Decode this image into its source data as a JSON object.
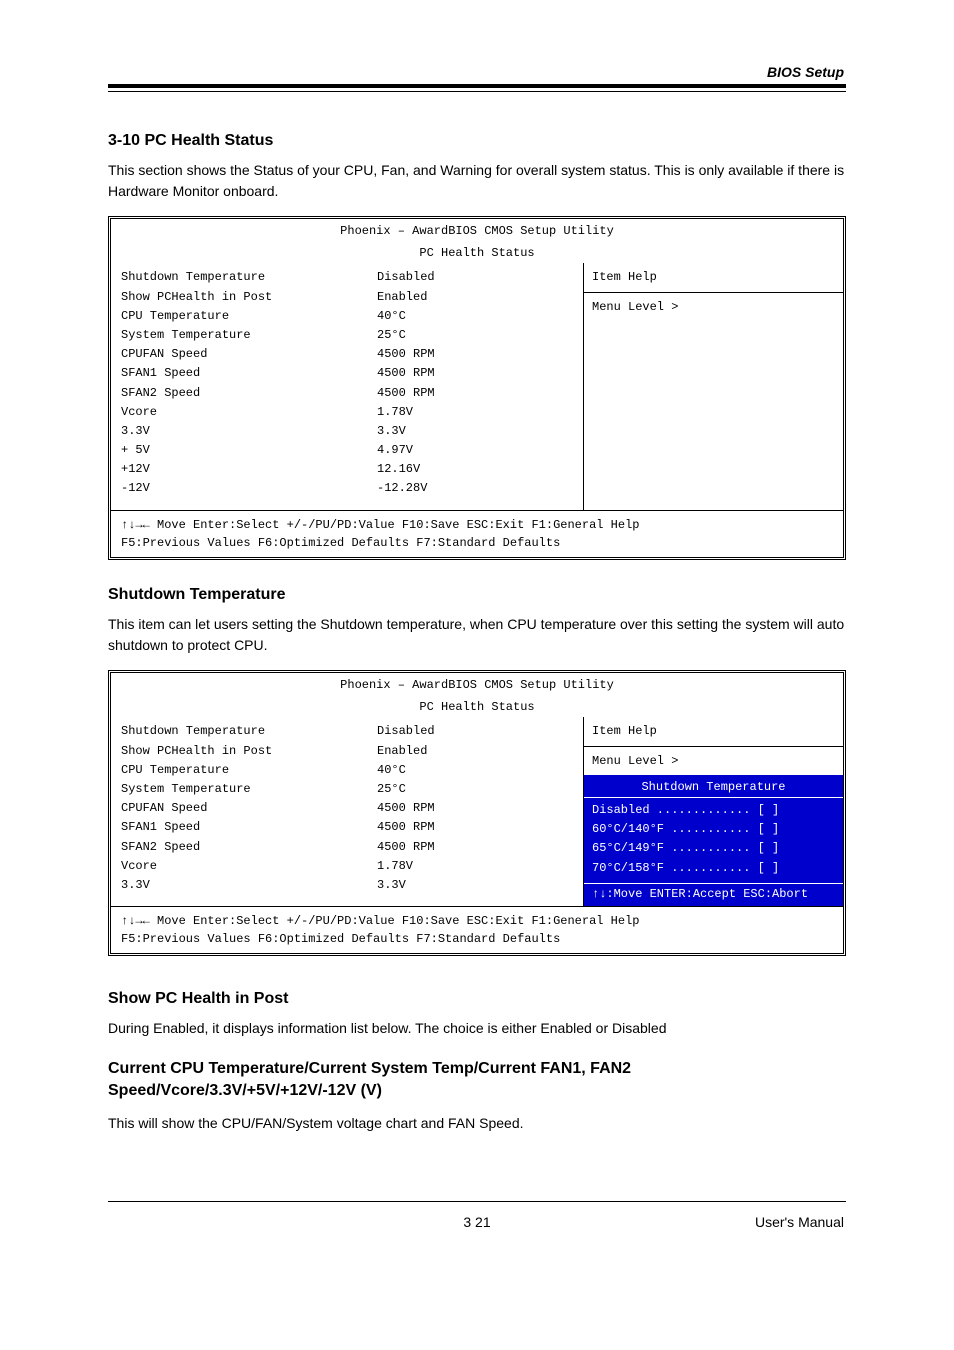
{
  "header": "BIOS Setup",
  "section1": {
    "title": "3-10 PC Health Status",
    "sub": "This section shows the Status of your CPU, Fan, and Warning for overall system status. This is only available if there is Hardware Monitor onboard."
  },
  "bios1": {
    "title": "Phoenix – AwardBIOS CMOS Setup Utility",
    "left_header": "PC Health Status",
    "right_title": "Item Help",
    "right_body": "Menu Level  >",
    "left_rows": [
      {
        "label": "Shutdown Temperature",
        "value": "Disabled"
      },
      {
        "label": "Show PCHealth in Post",
        "value": "Enabled"
      },
      {
        "label": "CPU Temperature",
        "value": "40°C"
      },
      {
        "label": "System Temperature",
        "value": "25°C"
      },
      {
        "label": "CPUFAN Speed",
        "value": "4500 RPM"
      },
      {
        "label": "SFAN1 Speed",
        "value": "4500 RPM"
      },
      {
        "label": "SFAN2 Speed",
        "value": "4500 RPM"
      },
      {
        "label": "Vcore",
        "value": "1.78V"
      },
      {
        "label": "3.3V",
        "value": "3.3V"
      },
      {
        "label": "+ 5V",
        "value": "4.97V"
      },
      {
        "label": "+12V",
        "value": "12.16V"
      },
      {
        "label": " -12V",
        "value": "-12.28V"
      }
    ],
    "foot1": "↑↓→← Move Enter:Select  +/-/PU/PD:Value  F10:Save  ESC:Exit  F1:General Help",
    "foot2": "F5:Previous Values    F6:Optimized Defaults    F7:Standard Defaults"
  },
  "section2": {
    "title": "Shutdown Temperature",
    "sub": "This item can let users setting the Shutdown temperature, when CPU temperature over this setting the system will auto shutdown to protect CPU."
  },
  "bios2": {
    "title": "Phoenix – AwardBIOS CMOS Setup Utility",
    "left_header": "PC Health Status",
    "right_title": "Item Help",
    "right_body": "Menu Level >",
    "left_rows": [
      {
        "label": "Shutdown Temperature",
        "value": "Disabled"
      },
      {
        "label": "Show PCHealth in Post",
        "value": "Enabled"
      },
      {
        "label": "CPU Temperature",
        "value": "40°C"
      },
      {
        "label": "System Temperature",
        "value": "25°C"
      },
      {
        "label": "CPUFAN Speed",
        "value": "4500 RPM"
      },
      {
        "label": "SFAN1 Speed",
        "value": "4500 RPM"
      },
      {
        "label": "SFAN2 Speed",
        "value": "4500 RPM"
      },
      {
        "label": "Vcore",
        "value": "1.78V"
      },
      {
        "label": "3.3V",
        "value": "3.3V"
      }
    ],
    "popup_title": "Shutdown Temperature",
    "popup": [
      "Disabled ............. [  ]",
      "60°C/140°F ........... [  ]",
      "65°C/149°F ........... [  ]",
      "70°C/158°F ........... [  ]"
    ],
    "popup_foot": "↑↓:Move  ENTER:Accept  ESC:Abort",
    "foot1": "↑↓→← Move Enter:Select  +/-/PU/PD:Value  F10:Save  ESC:Exit  F1:General Help",
    "foot2": "F5:Previous Values    F6:Optimized Defaults    F7:Standard Defaults"
  },
  "section3": {
    "title": "Show PC Health in Post",
    "sub_prefix": "During Enabled, it displays information list below. The choice is either Enabled or Disabled"
  },
  "section4": {
    "title": "Current CPU Temperature/Current System Temp/Current FAN1, FAN2 Speed/Vcore/3.3V/+5V/+12V/-12V (V)",
    "sub": "This will show the CPU/FAN/System voltage chart and FAN Speed."
  },
  "footer_text": "User's Manual",
  "footer_pg": "3   21"
}
